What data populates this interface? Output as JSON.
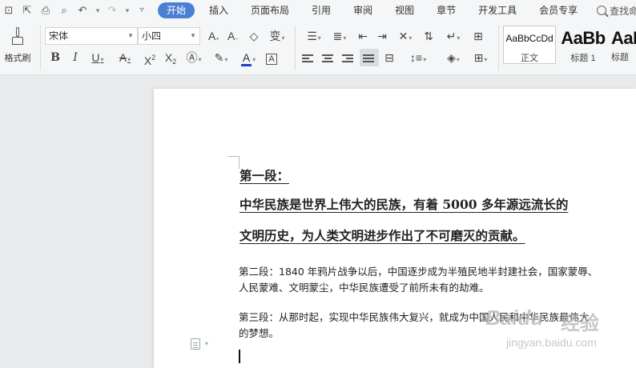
{
  "menubar": {
    "tabs": [
      "开始",
      "插入",
      "页面布局",
      "引用",
      "审阅",
      "视图",
      "章节",
      "开发工具",
      "会员专享"
    ],
    "search_placeholder": "查找命令、"
  },
  "ribbon": {
    "format_painter_label": "格式刷",
    "font_name": "宋体",
    "font_size": "小四",
    "styles": [
      {
        "sample": "AaBbCcDd",
        "name": "正文"
      },
      {
        "sample": "AaBb",
        "name": "标题 1"
      },
      {
        "sample": "AaE",
        "name": "标题"
      }
    ]
  },
  "document": {
    "heading1": "第一段：",
    "heading2": "中华民族是世界上伟大的民族，有着 5000 多年源远流长的",
    "heading3": "文明历史，为人类文明进步作出了不可磨灭的贡献。",
    "para2_line1": "第二段：1840 年鸦片战争以后，中国逐步成为半殖民地半封建社会，国家蒙辱、",
    "para2_line2": "人民蒙难、文明蒙尘，中华民族遭受了前所未有的劫难。",
    "para3_line1": "第三段：从那时起，实现中华民族伟大复兴，就成为中国人民和中华民族最伟大",
    "para3_line2": "的梦想。"
  },
  "watermark": {
    "brand": "Baidu",
    "suffix": "经验",
    "url": "jingyan.baidu.com"
  }
}
